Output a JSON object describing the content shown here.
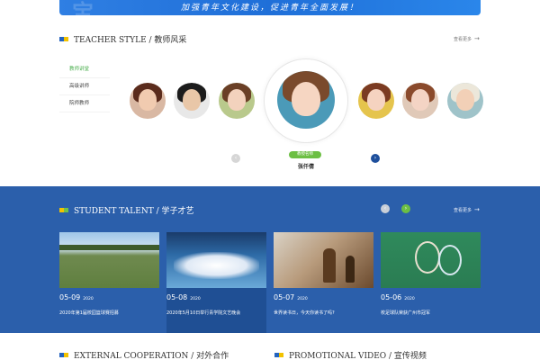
{
  "banner": {
    "slogan": "加强青年文化建设，促进青年全面发展！",
    "watermark": "宝"
  },
  "teacher": {
    "title": "TEACHER STYLE / 教师风采",
    "more": "查看更多",
    "tabs": [
      "教师讲堂",
      "高级讲师",
      "院师教师"
    ],
    "badge": "教授名师",
    "name": "张仟倩",
    "prev_icon": "chevron-left-icon",
    "next_icon": "chevron-right-icon"
  },
  "talent": {
    "title": "STUDENT TALENT / 学子才艺",
    "more": "查看更多",
    "cards": [
      {
        "day": "05-09",
        "year": "2020",
        "caption": "2020年第1届校园篮球赛招募"
      },
      {
        "day": "05-08",
        "year": "2020",
        "caption": "2020年5月10日举行青学院文艺晚会"
      },
      {
        "day": "05-07",
        "year": "2020",
        "caption": "世界读书日，今天你读书了吗?"
      },
      {
        "day": "05-06",
        "year": "2020",
        "caption": "校足球队荣获广州市冠军"
      }
    ]
  },
  "bottom": {
    "left_title": "EXTERNAL COOPERATION / 对外合作",
    "right_title": "PROMOTIONAL VIDEO / 宣传视频"
  },
  "colors": {
    "brand_blue": "#2b5fab",
    "accent_green": "#6cbf43",
    "accent_yellow": "#f2c200"
  }
}
